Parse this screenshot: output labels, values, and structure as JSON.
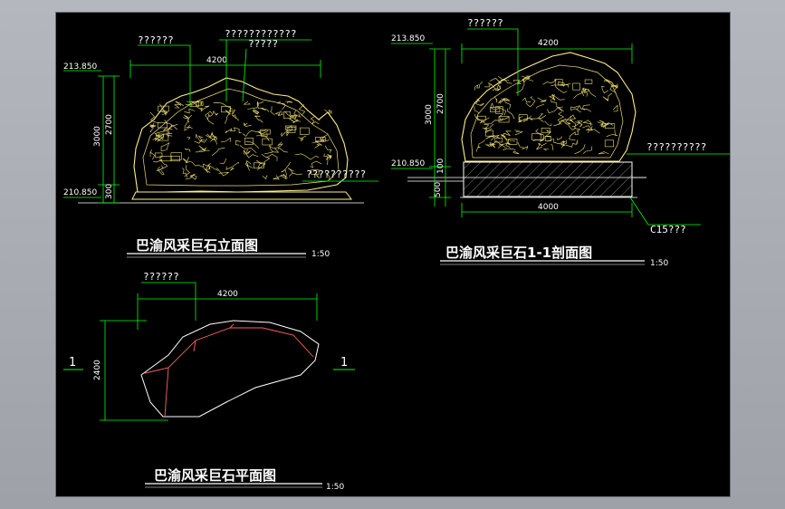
{
  "elevation": {
    "title": "巴渝风采巨石立面图",
    "scale": "1:50",
    "top_level": "213.850",
    "bottom_level": "210.850",
    "dim_width": "4200",
    "dim_height_total": "3000",
    "dim_height_rock": "2700",
    "dim_base": "300",
    "callout_left": "??????",
    "callout_top_1": "????????????",
    "callout_top_2": "?????",
    "callout_right": "??????????"
  },
  "section": {
    "title": "巴渝风采巨石1-1剖面图",
    "scale": "1:50",
    "top_level": "213.850",
    "ground_level": "210.850",
    "dim_width_top": "4200",
    "dim_width_bottom": "4000",
    "dim_height_total": "3000",
    "dim_height_rock": "2700",
    "dim_base": "500",
    "dim_small": "100",
    "callout_top": "??????",
    "callout_right": "??????????",
    "callout_base": "C15???"
  },
  "plan": {
    "title": "巴渝风采巨石平面图",
    "scale": "1:50",
    "dim_width": "4200",
    "dim_height": "2400",
    "callout_top": "??????",
    "section_mark_left": "1",
    "section_mark_right": "1"
  },
  "colors": {
    "background": "#000000",
    "dimension": "#00ff00",
    "rock_outline": "#ffee88",
    "rock_detail": "#f0e070",
    "ridge_line": "#ff6060",
    "text": "#ffffff"
  }
}
